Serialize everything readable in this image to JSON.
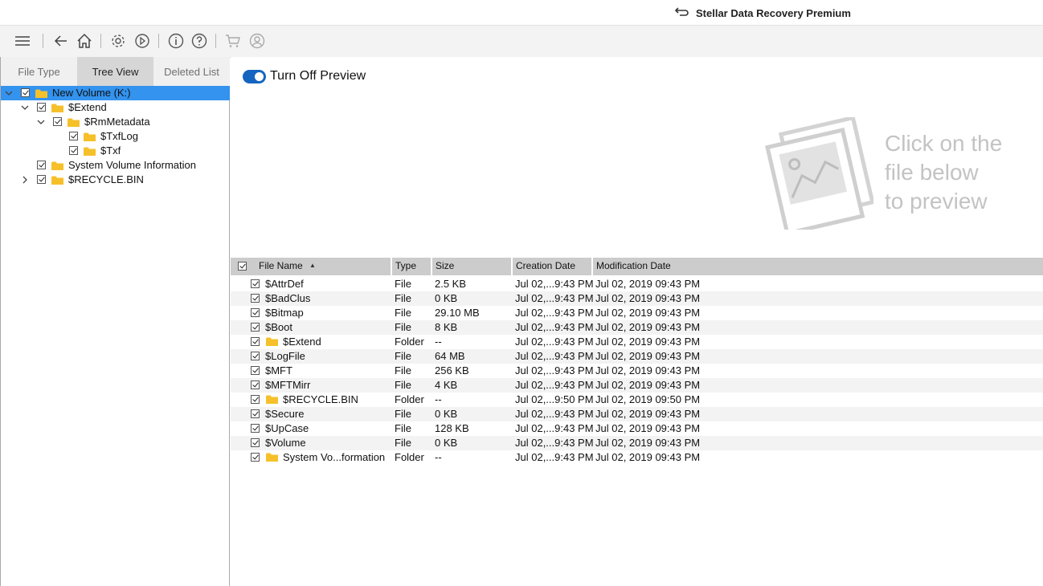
{
  "app": {
    "title": "Stellar Data Recovery Premium"
  },
  "toolbar": {
    "icons": [
      "menu-icon",
      "back-icon",
      "home-icon",
      "settings-icon",
      "history-icon",
      "info-icon",
      "help-icon",
      "cart-icon",
      "account-icon"
    ]
  },
  "left_tabs": [
    {
      "label": "File Type",
      "active": false
    },
    {
      "label": "Tree View",
      "active": true
    },
    {
      "label": "Deleted List",
      "active": false
    }
  ],
  "tree": [
    {
      "label": "New Volume (K:)",
      "level": 0,
      "expander": "down",
      "selected": true
    },
    {
      "label": "$Extend",
      "level": 1,
      "expander": "down",
      "selected": false
    },
    {
      "label": "$RmMetadata",
      "level": 2,
      "expander": "down",
      "selected": false
    },
    {
      "label": "$TxfLog",
      "level": 3,
      "expander": "none",
      "selected": false
    },
    {
      "label": "$Txf",
      "level": 3,
      "expander": "none",
      "selected": false
    },
    {
      "label": "System Volume Information",
      "level": 1,
      "expander": "none",
      "selected": false
    },
    {
      "label": "$RECYCLE.BIN",
      "level": 1,
      "expander": "right",
      "selected": false
    }
  ],
  "preview": {
    "toggle_label": "Turn Off Preview",
    "toggle_on": true,
    "placeholder_lines": [
      "Click on the",
      "file below",
      "to preview"
    ]
  },
  "table": {
    "columns": [
      "File Name",
      "Type",
      "Size",
      "Creation Date",
      "Modification Date"
    ],
    "rows": [
      {
        "name": "$AttrDef",
        "type": "File",
        "size": "2.5 KB",
        "created": "Jul 02,...9:43 PM",
        "modified": "Jul 02, 2019 09:43 PM",
        "folder": false
      },
      {
        "name": "$BadClus",
        "type": "File",
        "size": "0 KB",
        "created": "Jul 02,...9:43 PM",
        "modified": "Jul 02, 2019 09:43 PM",
        "folder": false
      },
      {
        "name": "$Bitmap",
        "type": "File",
        "size": "29.10 MB",
        "created": "Jul 02,...9:43 PM",
        "modified": "Jul 02, 2019 09:43 PM",
        "folder": false
      },
      {
        "name": "$Boot",
        "type": "File",
        "size": "8 KB",
        "created": "Jul 02,...9:43 PM",
        "modified": "Jul 02, 2019 09:43 PM",
        "folder": false
      },
      {
        "name": "$Extend",
        "type": "Folder",
        "size": "--",
        "created": "Jul 02,...9:43 PM",
        "modified": "Jul 02, 2019 09:43 PM",
        "folder": true
      },
      {
        "name": "$LogFile",
        "type": "File",
        "size": "64 MB",
        "created": "Jul 02,...9:43 PM",
        "modified": "Jul 02, 2019 09:43 PM",
        "folder": false
      },
      {
        "name": "$MFT",
        "type": "File",
        "size": "256 KB",
        "created": "Jul 02,...9:43 PM",
        "modified": "Jul 02, 2019 09:43 PM",
        "folder": false
      },
      {
        "name": "$MFTMirr",
        "type": "File",
        "size": "4 KB",
        "created": "Jul 02,...9:43 PM",
        "modified": "Jul 02, 2019 09:43 PM",
        "folder": false
      },
      {
        "name": "$RECYCLE.BIN",
        "type": "Folder",
        "size": "--",
        "created": "Jul 02,...9:50 PM",
        "modified": "Jul 02, 2019 09:50 PM",
        "folder": true
      },
      {
        "name": "$Secure",
        "type": "File",
        "size": "0 KB",
        "created": "Jul 02,...9:43 PM",
        "modified": "Jul 02, 2019 09:43 PM",
        "folder": false
      },
      {
        "name": "$UpCase",
        "type": "File",
        "size": "128 KB",
        "created": "Jul 02,...9:43 PM",
        "modified": "Jul 02, 2019 09:43 PM",
        "folder": false
      },
      {
        "name": "$Volume",
        "type": "File",
        "size": "0 KB",
        "created": "Jul 02,...9:43 PM",
        "modified": "Jul 02, 2019 09:43 PM",
        "folder": false
      },
      {
        "name": "System Vo...formation",
        "type": "Folder",
        "size": "--",
        "created": "Jul 02,...9:43 PM",
        "modified": "Jul 02, 2019 09:43 PM",
        "folder": true
      }
    ]
  },
  "colors": {
    "selection": "#3393ee",
    "toggle": "#1565c0",
    "folder": "#f6c02b",
    "placeholder": "#c3c3c3"
  }
}
